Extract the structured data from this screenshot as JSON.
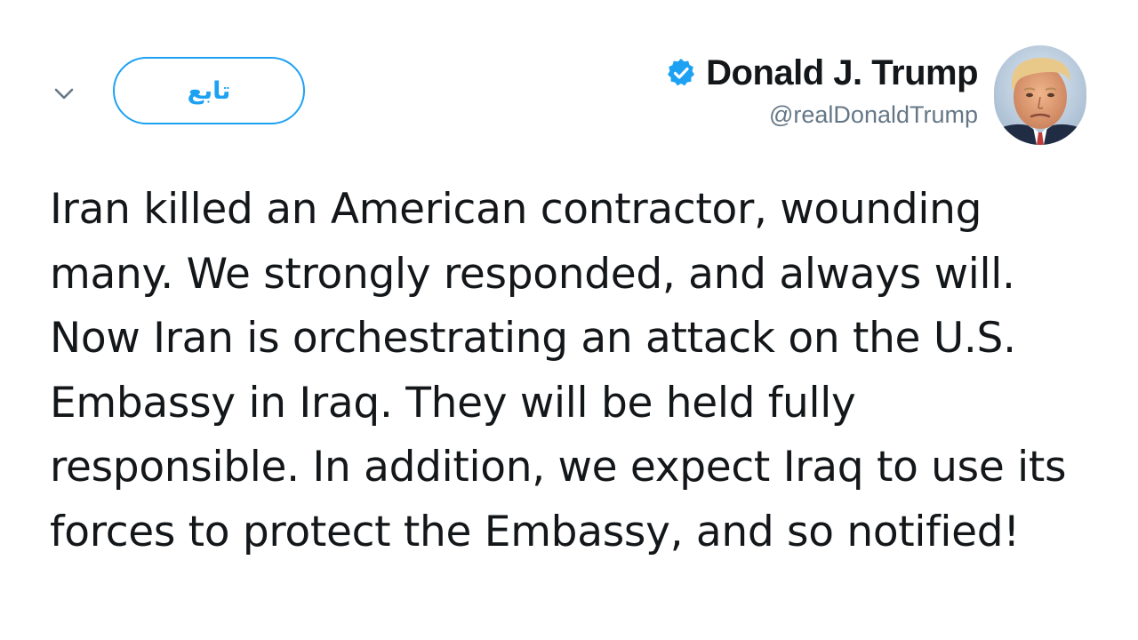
{
  "header": {
    "menu_icon": "chevron-down-icon",
    "follow_label": "تابع",
    "display_name": "Donald J. Trump",
    "handle": "@realDonaldTrump",
    "verified_icon": "verified-badge-icon",
    "avatar": "profile-photo"
  },
  "tweet": {
    "text": "Iran killed an American contractor, wounding many. We strongly responded, and always will. Now Iran is orchestrating an attack on the U.S. Embassy in Iraq. They will be held fully responsible. In addition, we expect Iraq to use its forces to protect the Embassy, and so notified!"
  },
  "colors": {
    "accent": "#1da1f2",
    "text": "#14171a",
    "secondary_text": "#657786"
  }
}
